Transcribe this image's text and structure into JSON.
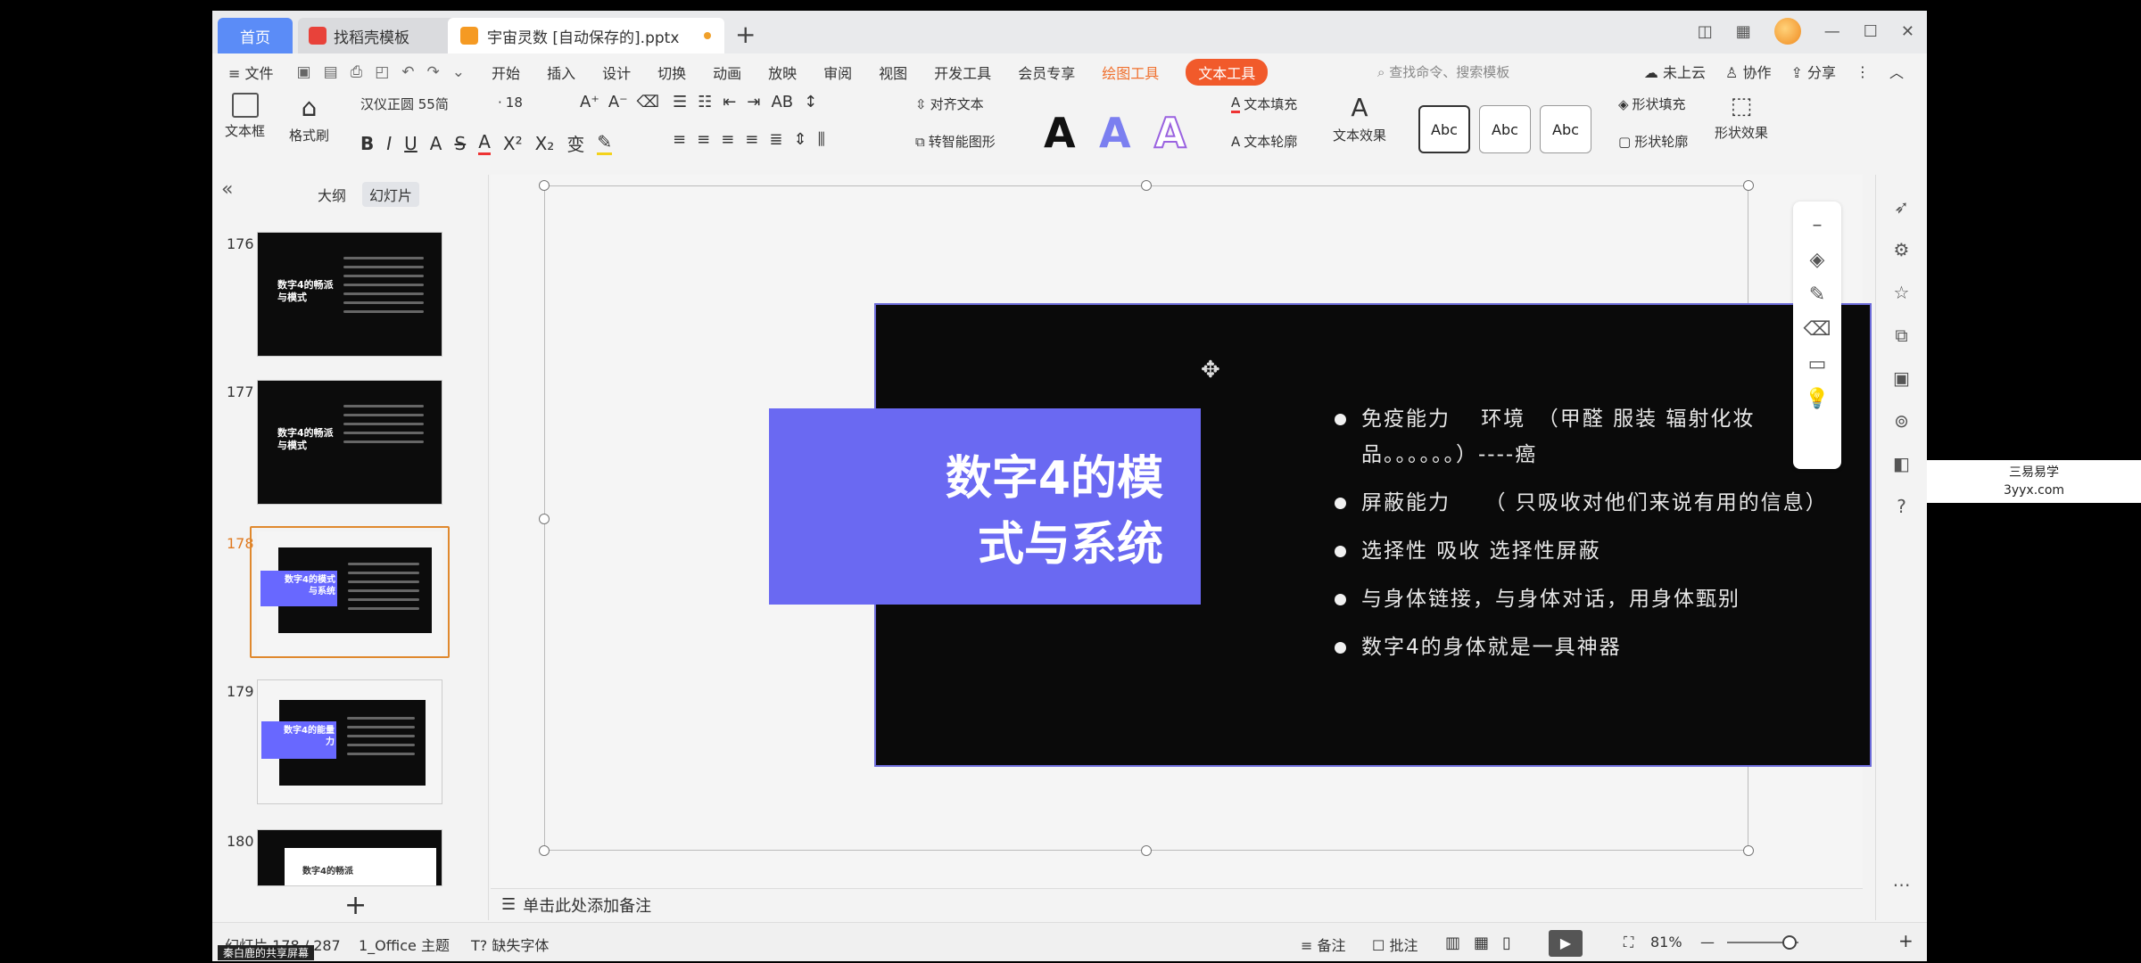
{
  "tabs": {
    "home": "首页",
    "template": "找稻壳模板",
    "doc": "宇宙灵数 [自动保存的].pptx"
  },
  "menu": {
    "file": "≡ 文件",
    "items": [
      "开始",
      "插入",
      "设计",
      "切换",
      "动画",
      "放映",
      "审阅",
      "视图",
      "开发工具",
      "会员专享"
    ],
    "draw_tools": "绘图工具",
    "text_tools": "文本工具",
    "search_placeholder": "查找命令、搜索模板",
    "cloud": "未上云",
    "collab": "协作",
    "share": "分享"
  },
  "ribbon": {
    "textbox": "文本框",
    "format_painter": "格式刷",
    "font_name": "汉仪正圆 55简",
    "font_size": "18",
    "align_text": "对齐文本",
    "smart_shape": "转智能图形",
    "text_fill": "文本填充",
    "text_outline": "文本轮廓",
    "text_effect": "文本效果",
    "abc": "Abc",
    "shape_fill": "形状填充",
    "shape_outline": "形状轮廓",
    "shape_effect": "形状效果"
  },
  "left_panel": {
    "outline": "大纲",
    "slides": "幻灯片",
    "thumbs": [
      {
        "num": "176",
        "title": "数字4的畅派与模式"
      },
      {
        "num": "177",
        "title": "数字4的畅派与模式"
      },
      {
        "num": "178",
        "title": "数字4的模式与系统"
      },
      {
        "num": "179",
        "title": "数字4的能量力"
      },
      {
        "num": "180",
        "title": "数字4的畅派"
      }
    ]
  },
  "slide": {
    "title_line1": "数字4的模",
    "title_line2": "式与系统",
    "bullets": [
      "免疫能力　 环境　（甲醛 服装 辐射化妆品。。。。。。）----癌",
      "屏蔽能力　　（ 只吸收对他们来说有用的信息）",
      "选择性 吸收 选择性屏蔽",
      "与身体链接，与身体对话，用身体甄别",
      "数字4的身体就是一具神器"
    ]
  },
  "notes_placeholder": "单击此处添加备注",
  "status": {
    "slide_count": "幻灯片 178 / 287",
    "theme": "1_Office 主题",
    "missing_font": "缺失字体",
    "notes": "备注",
    "comments": "批注",
    "zoom": "81%"
  },
  "watermark": {
    "line1": "三易易学",
    "line2": "3yyx.com"
  },
  "share_label": "秦白鹿的共享屏幕",
  "colors": {
    "accent_purple": "#6a69f2",
    "accent_orange": "#f15a2b",
    "home_tab": "#5b8cf7"
  }
}
